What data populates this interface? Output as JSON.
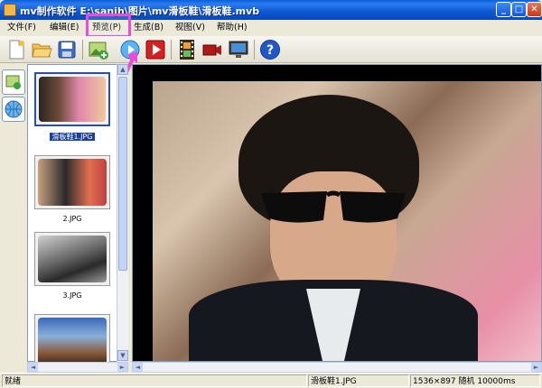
{
  "window": {
    "title": "mv制作软件 E:\\sanjh\\图片\\mv滑板鞋\\滑板鞋.mvb",
    "min_glyph": "_",
    "max_glyph": "□",
    "close_glyph": "✕"
  },
  "menu": [
    {
      "label": "文件(F)"
    },
    {
      "label": "编辑(E)"
    },
    {
      "label": "预览(P)"
    },
    {
      "label": "生成(B)"
    },
    {
      "label": "视图(V)"
    },
    {
      "label": "帮助(H)"
    }
  ],
  "toolbar": {
    "icons": [
      "new-icon",
      "open-icon",
      "save-icon",
      "add-image-icon",
      "play-icon",
      "play-red-icon",
      "film-icon",
      "record-icon",
      "screen-icon",
      "help-icon"
    ],
    "help_glyph": "?"
  },
  "thumbnails": [
    {
      "label": "滑板鞋1.JPG",
      "selected": true
    },
    {
      "label": "2.JPG",
      "selected": false
    },
    {
      "label": "3.JPG",
      "selected": false
    },
    {
      "label": "",
      "selected": false
    }
  ],
  "scroll": {
    "up": "▲",
    "down": "▼",
    "left": "◄",
    "right": "►"
  },
  "status": {
    "state": "就绪",
    "file": "滑板鞋1.JPG",
    "info": "1536×897 随机 10000ms"
  },
  "colors": {
    "annotation": "#f04bd8",
    "titlebar": "#0a5fd8"
  }
}
